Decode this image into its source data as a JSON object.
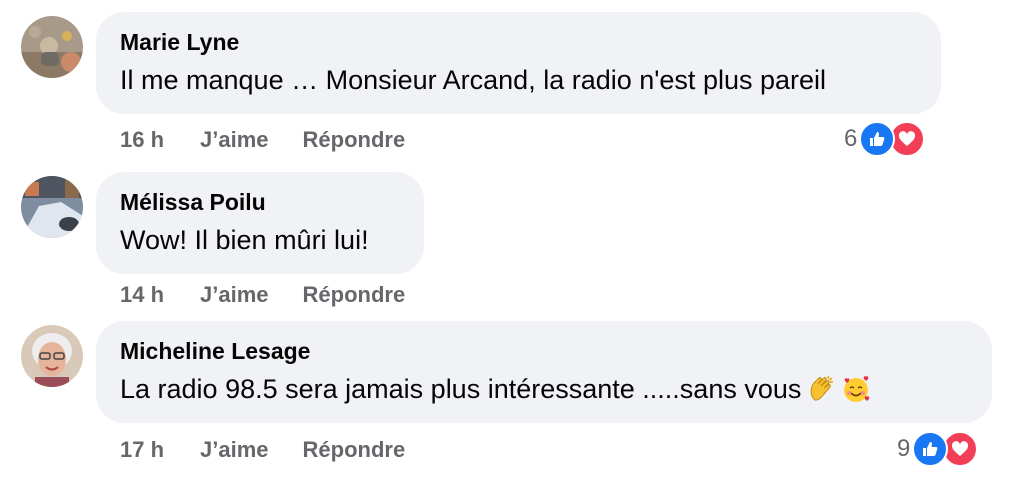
{
  "colors": {
    "bubble": "#f0f2f5",
    "meta_text": "#65676b",
    "like_blue": "#1877f2",
    "love_red": "#f33e58"
  },
  "comments": [
    {
      "author": "Marie Lyne",
      "text": "Il me manque … Monsieur Arcand, la radio n'est plus pareil",
      "time": "16 h",
      "like_label": "J’aime",
      "reply_label": "Répondre",
      "reaction_count": "6",
      "reaction_icons": [
        "like-icon",
        "love-icon"
      ]
    },
    {
      "author": "Mélissa Poilu",
      "text": "Wow! Il bien mûri lui!",
      "time": "14 h",
      "like_label": "J’aime",
      "reply_label": "Répondre"
    },
    {
      "author": "Micheline Lesage",
      "text": "La radio 98.5 sera jamais plus intéressante .....sans vous",
      "emojis": [
        "clapping-hands-icon",
        "smiling-face-with-hearts-icon"
      ],
      "time": "17 h",
      "like_label": "J’aime",
      "reply_label": "Répondre",
      "reaction_count": "9",
      "reaction_icons": [
        "like-icon",
        "love-icon"
      ]
    }
  ]
}
